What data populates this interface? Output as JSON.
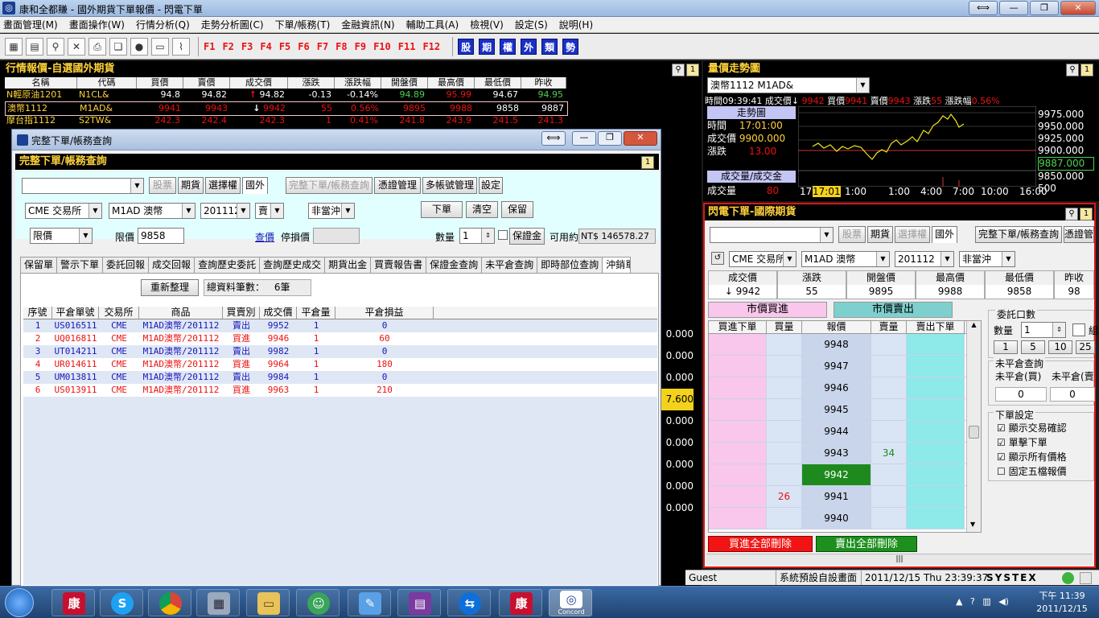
{
  "app": {
    "title": "康和全都賺 - 國外期貨下單報價 - 閃電下單",
    "icon_text": "◎"
  },
  "window_buttons": [
    "⟺",
    "—",
    "❐",
    "✕"
  ],
  "menu": [
    "畫面管理(M)",
    "畫面操作(W)",
    "行情分析(Q)",
    "走勢分析圖(C)",
    "下單/帳務(T)",
    "金融資訊(N)",
    "輔助工具(A)",
    "檢視(V)",
    "設定(S)",
    "說明(H)"
  ],
  "toolbar": {
    "fkeys": [
      "F1",
      "F2",
      "F3",
      "F4",
      "F5",
      "F6",
      "F7",
      "F8",
      "F9",
      "F10",
      "F11",
      "F12"
    ],
    "blue_keys": [
      "股",
      "期",
      "權",
      "外",
      "類",
      "勢"
    ]
  },
  "quote": {
    "title": "行情報價-自選國外期貨",
    "headers": [
      "名稱",
      "代碼",
      "買價",
      "賣價",
      "成交價",
      "漲跌",
      "漲跌幅",
      "開盤價",
      "最高價",
      "最低價",
      "昨收"
    ],
    "rows": [
      {
        "name": "N輕原油1201",
        "code": "N1CL&",
        "bid": "94.8",
        "ask": "94.82",
        "arrow": "↑",
        "last": "94.82",
        "chg": "-0.13",
        "pct": "-0.14%",
        "open": "94.89",
        "high": "95.99",
        "low": "94.67",
        "prev": "94.95"
      },
      {
        "name": "澳幣1112",
        "code": "M1AD&",
        "bid": "9941",
        "ask": "9943",
        "arrow": "↓",
        "last": "9942",
        "chg": "55",
        "pct": "0.56%",
        "open": "9895",
        "high": "9988",
        "low": "9858",
        "prev": "9887"
      },
      {
        "name": "摩台指1112",
        "code": "S2TW&",
        "bid": "242.3",
        "ask": "242.4",
        "arrow": "",
        "last": "242.3",
        "chg": "1",
        "pct": "0.41%",
        "open": "241.8",
        "high": "243.9",
        "low": "241.5",
        "prev": "241.3"
      }
    ],
    "right_values": [
      "0.000",
      "0.000",
      "0.000",
      "7.600",
      "0.000",
      "0.000",
      "0.000",
      "0.000",
      "0.000"
    ]
  },
  "trend": {
    "title": "量價走勢圖",
    "symbol": "澳幣1112 M1AD&",
    "info": {
      "time_label": "時間",
      "time": "09:39:41",
      "last_label": "成交價",
      "arrow": "↓",
      "last": "9942",
      "bid_label": "買價",
      "bid": "9941",
      "ask_label": "賣價",
      "ask": "9943",
      "chg_label": "漲跌",
      "chg": "55",
      "pct_label": "漲跌幅",
      "pct": "0.56%"
    },
    "box": {
      "title": "走勢圖",
      "time_label": "時間",
      "time": "17:01:00",
      "price_label": "成交價",
      "price": "9900.000",
      "chg_label": "漲跌",
      "chg": "13.00",
      "vol_title": "成交量/成交金",
      "vol_label": "成交量",
      "vol": "80"
    },
    "yaxis": [
      "9975.000",
      "9950.000",
      "9925.000",
      "9900.000",
      "9887.000",
      "9850.000",
      "500"
    ],
    "xaxis": [
      "17",
      "17:01",
      "1:00",
      "1:00",
      "4:00",
      "7:00",
      "10:00",
      "16:00"
    ]
  },
  "order": {
    "title": "完整下單/帳務查詢",
    "panel_title": "完整下單/帳務查詢",
    "tabs": [
      "股票",
      "期貨",
      "選擇權",
      "國外"
    ],
    "top_buttons": [
      "完整下單/帳務查詢",
      "憑證管理",
      "多帳號管理",
      "設定"
    ],
    "exchange": "CME 交易所",
    "product": "M1AD 澳幣",
    "month": "201112",
    "side": "賣",
    "offset": "非當沖",
    "actions": [
      "下單",
      "清空",
      "保留"
    ],
    "price_type": "限價",
    "limit_label": "限價",
    "limit": "9858",
    "query": "查價",
    "stop_label": "停損價",
    "qty_label": "數量",
    "qty": "1",
    "margin_btn": "保證金",
    "avail_label": "可用約",
    "avail": "NT$ 146578.27",
    "sub_tabs": [
      "保留單",
      "警示下單",
      "委託回報",
      "成交回報",
      "查詢歷史委託",
      "查詢歷史成交",
      "期貨出金",
      "買賣報告書",
      "保證金查詢",
      "未平倉查詢",
      "即時部位查詢",
      "沖銷單"
    ],
    "reorg": "重新整理",
    "total_label": "總資料筆數：",
    "total": "6筆",
    "grid_headers": [
      "序號",
      "平倉單號",
      "交易所",
      "商品",
      "買賣別",
      "成交價",
      "平倉量",
      "平倉損益"
    ],
    "grid_rows": [
      [
        "1",
        "US016511",
        "CME",
        "M1AD澳幣/201112",
        "賣出",
        "9952",
        "1",
        "0"
      ],
      [
        "2",
        "UQ016811",
        "CME",
        "M1AD澳幣/201112",
        "買進",
        "9946",
        "1",
        "60"
      ],
      [
        "3",
        "UT014211",
        "CME",
        "M1AD澳幣/201112",
        "賣出",
        "9982",
        "1",
        "0"
      ],
      [
        "4",
        "UR014611",
        "CME",
        "M1AD澳幣/201112",
        "買進",
        "9964",
        "1",
        "180"
      ],
      [
        "5",
        "UM013811",
        "CME",
        "M1AD澳幣/201112",
        "賣出",
        "9984",
        "1",
        "0"
      ],
      [
        "6",
        "US013911",
        "CME",
        "M1AD澳幣/201112",
        "買進",
        "9963",
        "1",
        "210"
      ]
    ]
  },
  "flash": {
    "title": "閃電下單-國際期貨",
    "tabs": [
      "股票",
      "期貨",
      "選擇權",
      "國外"
    ],
    "buttons": [
      "完整下單/帳務查詢",
      "憑證管"
    ],
    "exchange": "CME 交易所",
    "product": "M1AD 澳幣",
    "month": "201112",
    "offset": "非當沖",
    "info_headers": [
      "成交價",
      "漲跌",
      "開盤價",
      "最高價",
      "最低價",
      "昨收"
    ],
    "info_values": [
      "↓ 9942",
      "55",
      "9895",
      "9988",
      "9858",
      "98"
    ],
    "market_buy": "市價買進",
    "market_sell": "市價賣出",
    "ladder_headers": [
      "買進下單",
      "買量",
      "報價",
      "賣量",
      "賣出下單"
    ],
    "ladder": [
      {
        "price": "9948",
        "bid": "",
        "ask": ""
      },
      {
        "price": "9947",
        "bid": "",
        "ask": ""
      },
      {
        "price": "9946",
        "bid": "",
        "ask": ""
      },
      {
        "price": "9945",
        "bid": "",
        "ask": ""
      },
      {
        "price": "9944",
        "bid": "",
        "ask": ""
      },
      {
        "price": "9943",
        "bid": "",
        "ask": "34"
      },
      {
        "price": "9942",
        "bid": "",
        "ask": ""
      },
      {
        "price": "9941",
        "bid": "26",
        "ask": ""
      },
      {
        "price": "9940",
        "bid": "",
        "ask": ""
      }
    ],
    "order_qty": {
      "title": "委託口數",
      "qty_label": "數量",
      "qty": "1",
      "quick": [
        "1",
        "5",
        "10",
        "25"
      ],
      "extra": "組"
    },
    "open_pos": {
      "title": "未平倉查詢",
      "buy": "未平倉(買)",
      "sell": "未平倉(賣",
      "buy_val": "0",
      "sell_val": "0"
    },
    "settings": {
      "title": "下單設定",
      "items": [
        "顯示交易確認",
        "單擊下單",
        "顯示所有價格",
        "固定五檔報價"
      ],
      "checked": [
        true,
        true,
        true,
        false
      ]
    },
    "delete_buy": "買進全部刪除",
    "delete_sell": "賣出全部刪除"
  },
  "status": {
    "user": "Guest",
    "mode": "系統預設自設畫面",
    "datetime": "2011/12/15 Thu 23:39:37",
    "brand": "SYSTEX"
  },
  "taskbar": {
    "time": "下午 11:39",
    "date": "2011/12/15",
    "app_labels": [
      "Concord"
    ]
  },
  "colors": {
    "headline": "#ffd23b",
    "rise": "#ee1111",
    "fall": "#47d447",
    "bg": "#000000",
    "pink": "#f9c6ec",
    "cyan": "#8ee9e9",
    "current_price": "#1e8a1e"
  }
}
